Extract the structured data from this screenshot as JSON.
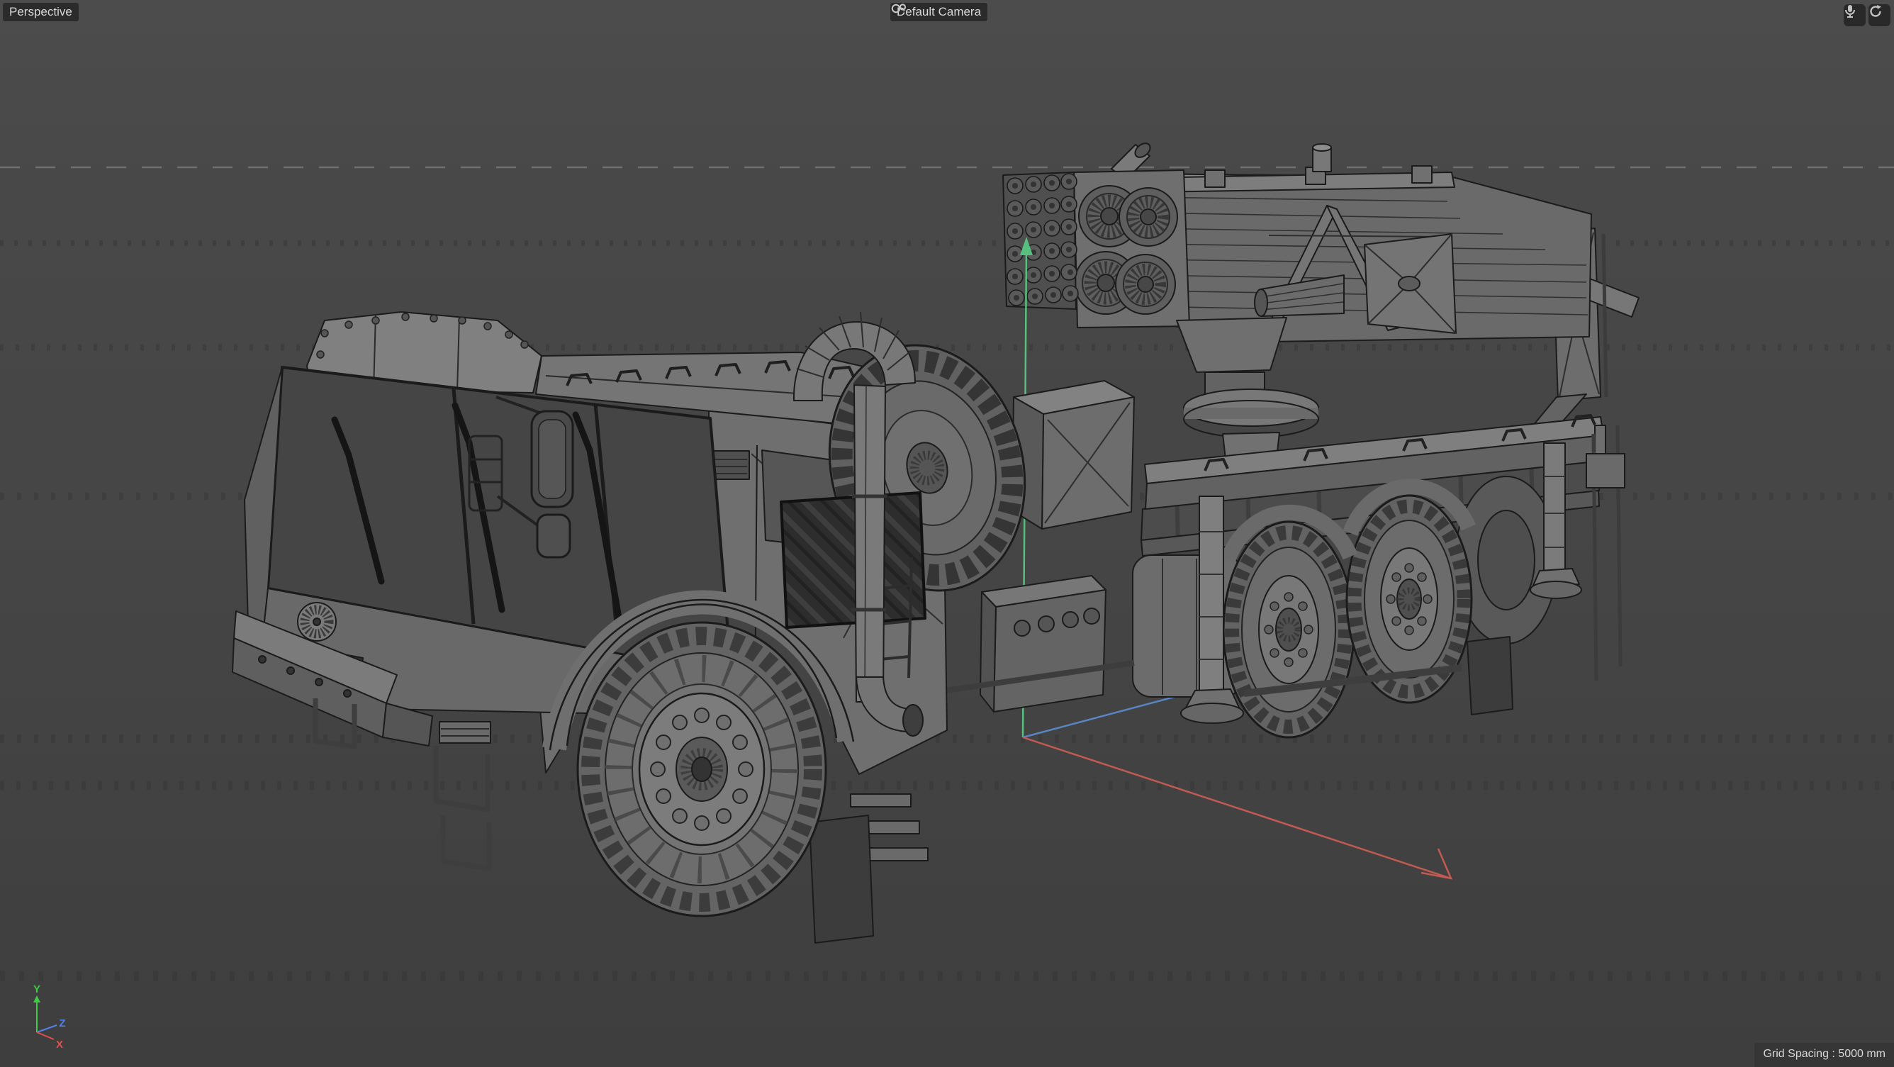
{
  "viewport": {
    "view_label": "Perspective",
    "camera_label": "Default Camera",
    "grid_spacing_label": "Grid Spacing : 5000 mm"
  },
  "topbar": {
    "buttons": [
      {
        "icon": "microphone-icon"
      },
      {
        "icon": "sync-icon"
      }
    ]
  },
  "axis_gizmo": {
    "labels": {
      "x": "X",
      "y": "Y",
      "z": "Z"
    },
    "colors": {
      "x": "#e14e4e",
      "y": "#3fcb43",
      "z": "#4f82e8"
    }
  },
  "world_axes": {
    "colors": {
      "x": "#c25a54",
      "y": "#58c07e",
      "z": "#5b84c4"
    }
  },
  "scene": {
    "description": "Wireframe 3D model of a heavy 6x6 military truck carrying a multiple rocket launcher, viewed in perspective",
    "background_color": "#454545",
    "wireframe_color": "#1b1b1b",
    "horizon_dash_color": "#707070"
  }
}
